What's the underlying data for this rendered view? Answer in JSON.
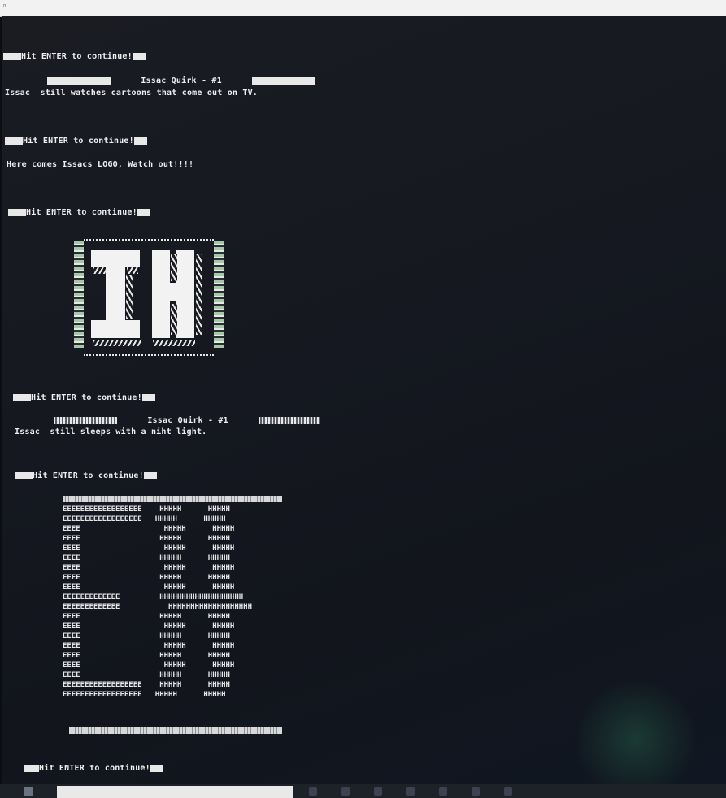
{
  "console": {
    "prompt": "Hit ENTER to continue!",
    "quirk_title": "Issac Quirk - #1",
    "quirk1_text": "Issac  still watches cartoons that come out on TV.",
    "logo_intro": "Here comes Issacs LOGO, Watch out!!!!",
    "quirk2_text": "Issac  still sleeps with a niht light."
  },
  "eh_logo": {
    "rows": [
      "EEEEEEEEEEEEEEEEEE    HHHHH      HHHHH",
      "EEEEEEEEEEEEEEEEEE   HHHHH      HHHHH",
      "EEEE                   HHHHH      HHHHH",
      "EEEE                  HHHHH      HHHHH",
      "EEEE                   HHHHH      HHHHH",
      "EEEE                  HHHHH      HHHHH",
      "EEEE                   HHHHH      HHHHH",
      "EEEE                  HHHHH      HHHHH",
      "EEEE                   HHHHH      HHHHH",
      "EEEEEEEEEEEEE         HHHHHHHHHHHHHHHHHHH",
      "EEEEEEEEEEEEE           HHHHHHHHHHHHHHHHHHH",
      "EEEE                  HHHHH      HHHHH",
      "EEEE                   HHHHH      HHHHH",
      "EEEE                  HHHHH      HHHHH",
      "EEEE                   HHHHH      HHHHH",
      "EEEE                  HHHHH      HHHHH",
      "EEEE                   HHHHH      HHHHH",
      "EEEE                  HHHHH      HHHHH",
      "EEEEEEEEEEEEEEEEEE    HHHHH      HHHHH",
      "EEEEEEEEEEEEEEEEEE   HHHHH      HHHHH"
    ]
  },
  "colors": {
    "background": "#151820",
    "text": "#eeeef0",
    "logo_accent": "#a5c9a6"
  }
}
